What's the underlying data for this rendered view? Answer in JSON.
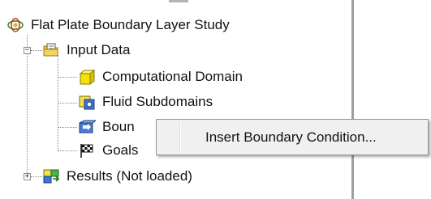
{
  "tree": {
    "root": {
      "label": "Flat Plate Boundary Layer Study",
      "icon": "project-icon"
    },
    "input_data": {
      "label": "Input Data",
      "expander": "−",
      "icon": "input-data-folder-icon",
      "children": [
        {
          "label": "Computational Domain",
          "icon": "computational-domain-icon"
        },
        {
          "label": "Fluid Subdomains",
          "icon": "fluid-subdomains-icon"
        },
        {
          "label": "Boundary Conditions",
          "visible_label": "Boun",
          "icon": "boundary-conditions-icon"
        },
        {
          "label": "Goals",
          "icon": "goals-flag-icon"
        }
      ]
    },
    "results": {
      "label": "Results (Not loaded)",
      "expander": "+",
      "icon": "results-icon"
    }
  },
  "context_menu": {
    "items": [
      {
        "label": "Insert Boundary Condition..."
      }
    ]
  },
  "colors": {
    "menu_bg": "#f0f0f0",
    "menu_border": "#979797",
    "panel_border": "#9aa0a8"
  }
}
